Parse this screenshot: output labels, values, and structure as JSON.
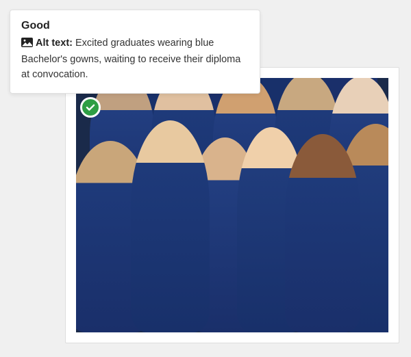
{
  "tooltip": {
    "heading": "Good",
    "label": "Alt text:",
    "description": "Excited graduates wearing blue Bachelor's gowns, waiting to receive their diploma at convocation."
  },
  "badge": {
    "status_color": "#2e9e44"
  },
  "image": {
    "alt": "Excited graduates wearing blue Bachelor's gowns, waiting to receive their diploma at convocation."
  }
}
